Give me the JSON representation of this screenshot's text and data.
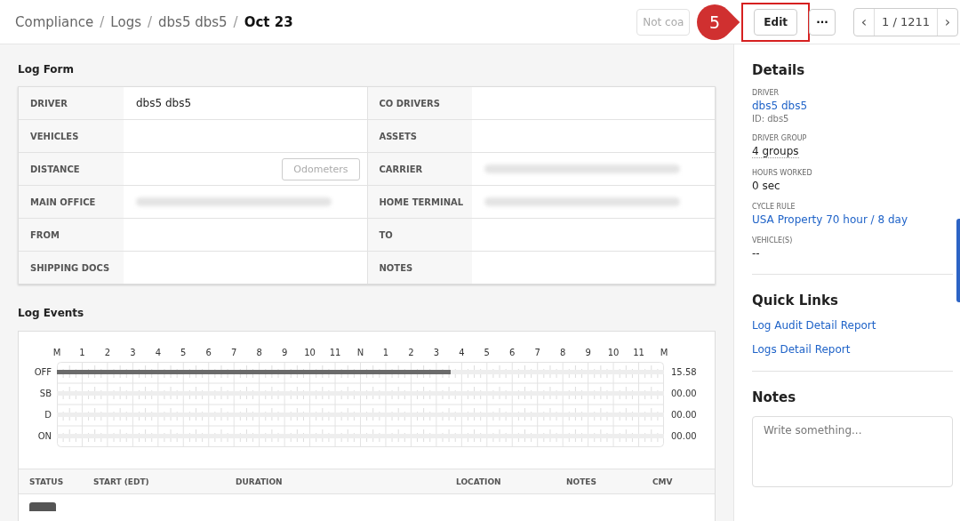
{
  "breadcrumb": [
    {
      "label": "Compliance",
      "current": false
    },
    {
      "separator": "/",
      "label": "Logs",
      "current": false
    },
    {
      "separator": "/",
      "label": "dbs5 dbs5",
      "current": false
    },
    {
      "separator": "/",
      "label": "Oct 23",
      "current": true
    }
  ],
  "toolbar": {
    "status_button": "Not coa",
    "step_callout": "5",
    "edit_button": "Edit",
    "more_button": "···",
    "pager": {
      "prev": "‹",
      "position": "1 / 1211",
      "next": "›"
    }
  },
  "log_form": {
    "title": "Log Form",
    "rows": [
      {
        "left": {
          "label": "DRIVER",
          "value": "dbs5 dbs5",
          "kind": "text"
        },
        "right": {
          "label": "CO DRIVERS",
          "kind": "empty"
        }
      },
      {
        "left": {
          "label": "VEHICLES",
          "kind": "empty"
        },
        "right": {
          "label": "ASSETS",
          "kind": "empty"
        }
      },
      {
        "left": {
          "label": "DISTANCE",
          "kind": "button",
          "button": "Odometers"
        },
        "right": {
          "label": "CARRIER",
          "kind": "redacted"
        }
      },
      {
        "left": {
          "label": "MAIN OFFICE",
          "kind": "redacted"
        },
        "right": {
          "label": "HOME TERMINAL",
          "kind": "redacted"
        }
      },
      {
        "left": {
          "label": "FROM",
          "kind": "empty"
        },
        "right": {
          "label": "TO",
          "kind": "empty"
        }
      },
      {
        "left": {
          "label": "SHIPPING DOCS",
          "kind": "empty"
        },
        "right": {
          "label": "NOTES",
          "kind": "empty"
        }
      }
    ]
  },
  "log_events": {
    "title": "Log Events",
    "hours": [
      "M",
      "1",
      "2",
      "3",
      "4",
      "5",
      "6",
      "7",
      "8",
      "9",
      "10",
      "11",
      "N",
      "1",
      "2",
      "3",
      "4",
      "5",
      "6",
      "7",
      "8",
      "9",
      "10",
      "11",
      "M"
    ],
    "statuses": [
      {
        "label": "OFF",
        "level": 0.649,
        "total": "15.58"
      },
      {
        "label": "SB",
        "total": "00.00"
      },
      {
        "label": "D",
        "total": "00.00"
      },
      {
        "label": "ON",
        "total": "00.00"
      }
    ],
    "table": {
      "columns": [
        "STATUS",
        "START (EDT)",
        "DURATION",
        "LOCATION",
        "NOTES",
        "CMV"
      ]
    }
  },
  "details": {
    "title": "Details",
    "fields": [
      {
        "label": "DRIVER",
        "value": "dbs5 dbs5",
        "kind": "link",
        "sub": "ID: dbs5"
      },
      {
        "label": "DRIVER GROUP",
        "value": "4 groups",
        "kind": "dotted"
      },
      {
        "label": "HOURS WORKED",
        "value": "0 sec",
        "kind": "text"
      },
      {
        "label": "CYCLE RULE",
        "value": "USA Property 70 hour / 8 day",
        "kind": "link"
      },
      {
        "label": "VEHICLE(S)",
        "value": "--",
        "kind": "text"
      }
    ]
  },
  "quick_links": {
    "title": "Quick Links",
    "links": [
      "Log Audit Detail Report",
      "Logs Detail Report"
    ]
  },
  "notes": {
    "title": "Notes",
    "placeholder": "Write something..."
  }
}
